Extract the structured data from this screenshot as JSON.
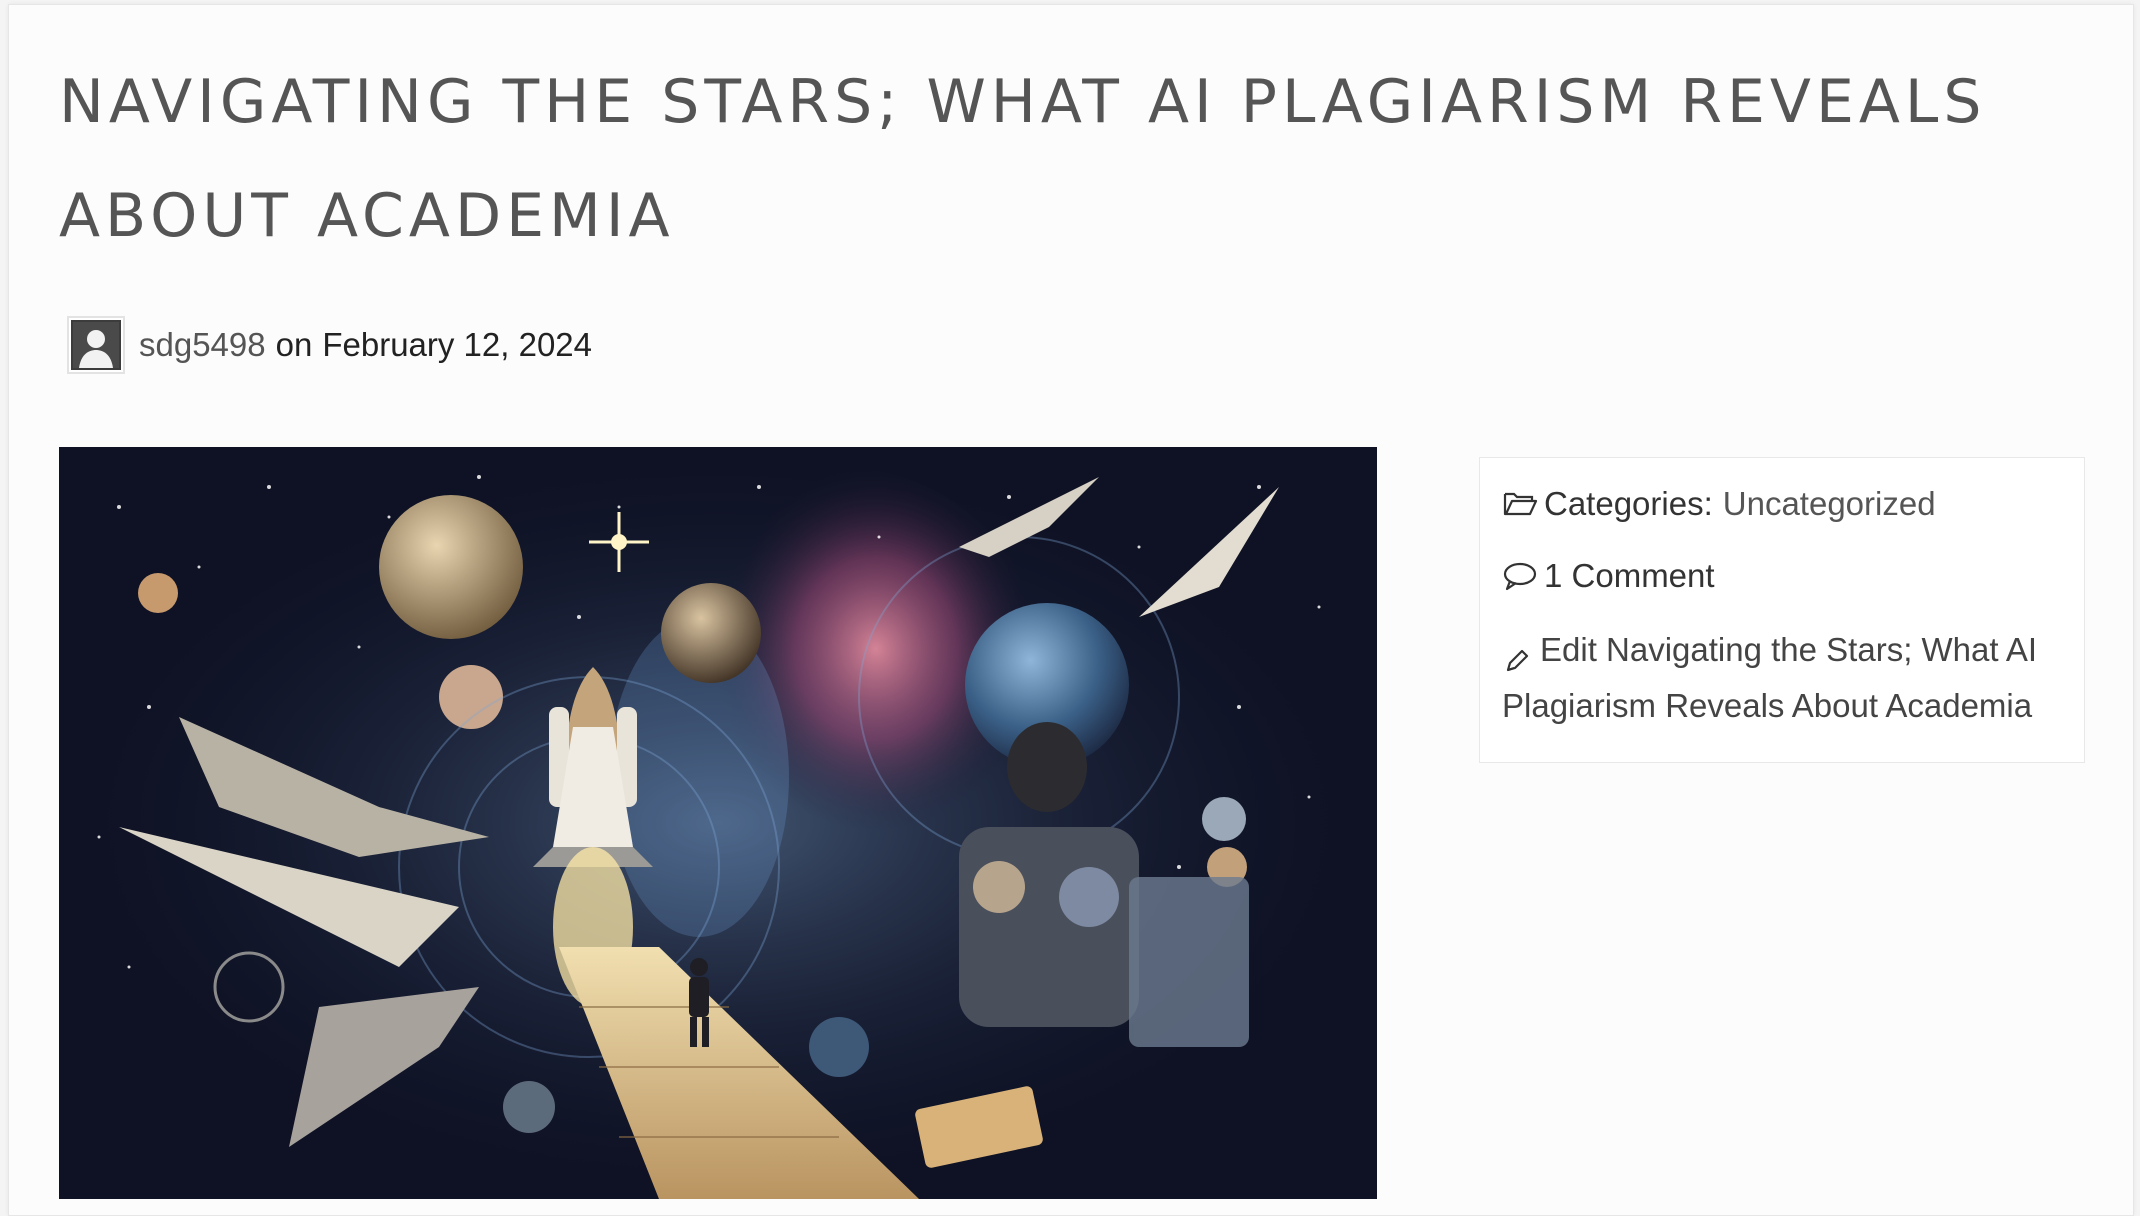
{
  "post": {
    "title": "NAVIGATING THE STARS; WHAT AI PLAGIARISM REVEALS ABOUT ACADEMIA",
    "author": "sdg5498",
    "on_word": "on",
    "date": "February 12, 2024"
  },
  "meta": {
    "categories_label": "Categories:",
    "category": "Uncategorized",
    "comments": "1 Comment",
    "edit_label": "Edit Navigating the Stars; What AI Plagiarism Reveals About Academia"
  },
  "icons": {
    "avatar": "user-avatar-icon",
    "categories": "folder-open-icon",
    "comments": "speech-bubble-icon",
    "edit": "pencil-icon"
  },
  "colors": {
    "title": "#555555",
    "link": "#555555",
    "text": "#222222",
    "background": "#fcfcfc"
  }
}
